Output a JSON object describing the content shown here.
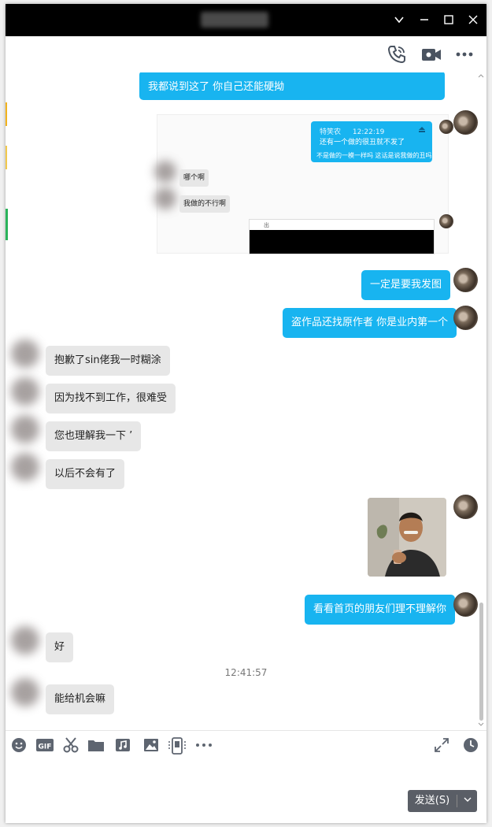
{
  "window": {
    "controls": {
      "dropdown": "⌄",
      "minimize": "—",
      "maximize": "☐",
      "close": "✕"
    }
  },
  "top_actions": [
    "phone-icon",
    "video-call-icon",
    "more-icon"
  ],
  "messages": {
    "top_partial": "我都说到这了 你自己还能硬拗",
    "screenshot": {
      "sender": "特笑农",
      "time": "12:22:19",
      "line1": "还有一个做的很丑就不发了",
      "line2": "不是做的一模一样吗 这话是说我做的丑吗",
      "incoming1": "哪个啊",
      "incoming2": "我做的不行啊",
      "window_label": "出"
    },
    "m1": "一定是要我发图",
    "m2": "盗作品还找原作者 你是业内第一个",
    "m3": "抱歉了sin佬我一时糊涂",
    "m4": "因为找不到工作，很难受",
    "m5": "您也理解我一下  ’",
    "m6": "以后不会有了",
    "m7": "看看首页的朋友们理不理解你",
    "m8": "好",
    "timestamp": "12:41:57",
    "m9": "能给机会嘛"
  },
  "input_toolbar": [
    "emoji-icon",
    "gif-icon",
    "scissors-icon",
    "folder-icon",
    "music-icon",
    "image-icon",
    "phone-screenshot-icon",
    "more-icon",
    "expand-icon",
    "history-icon"
  ],
  "send": {
    "label": "发送(S)"
  },
  "colors": {
    "outgoing": "#18b4f0",
    "incoming": "#e7e7e7",
    "titlebar": "#000000"
  }
}
